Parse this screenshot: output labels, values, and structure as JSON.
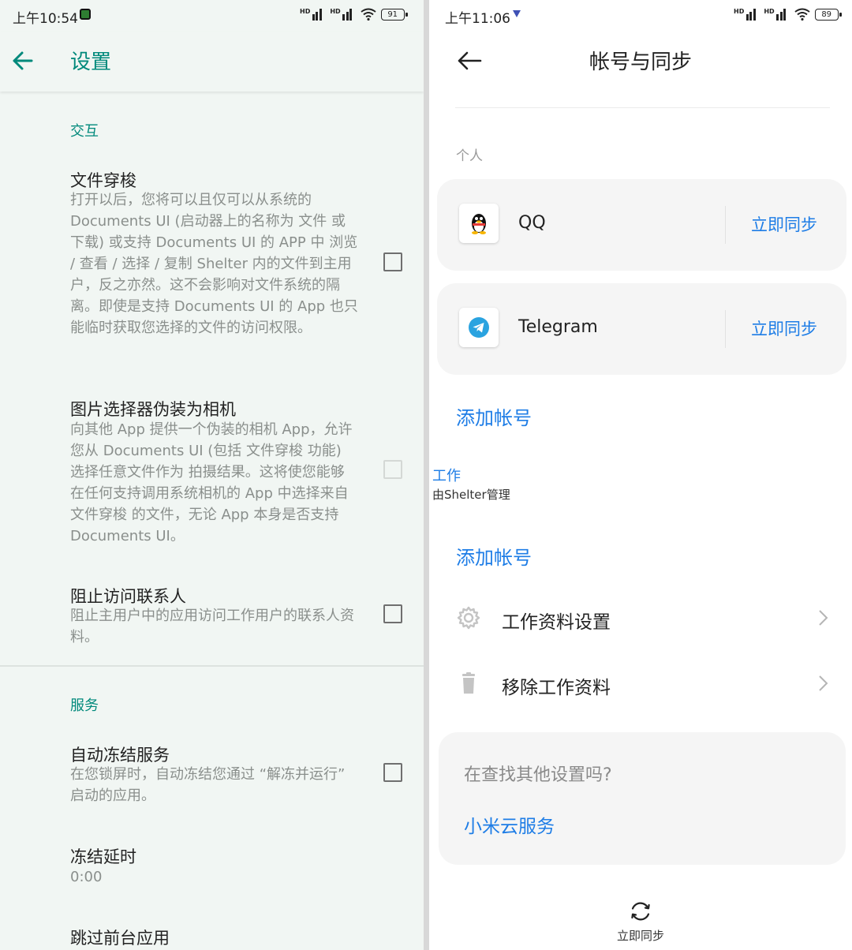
{
  "left": {
    "status_time": "上午10:54",
    "battery": "91",
    "title": "设置",
    "sections": [
      {
        "header": "交互",
        "items": [
          {
            "title": "文件穿梭",
            "summary": "打开以后，您将可以且仅可以从系统的 Documents UI (启动器上的名称为 文件 或 下载) 或支持 Documents UI 的 APP 中 浏览 / 查看 / 选择 / 复制 Shelter 内的文件到主用户，反之亦然。这不会影响对文件系统的隔离。即使是支持 Documents UI 的 App 也只能临时获取您选择的文件的访问权限。",
            "checked": false,
            "enabled": true
          },
          {
            "title": "图片选择器伪装为相机",
            "summary": "向其他 App 提供一个伪装的相机 App，允许您从 Documents UI (包括 文件穿梭 功能) 选择任意文件作为 拍摄结果。这将使您能够在任何支持调用系统相机的 App 中选择来自 文件穿梭 的文件，无论 App 本身是否支持 Documents UI。",
            "checked": false,
            "enabled": false
          },
          {
            "title": "阻止访问联系人",
            "summary": "阻止主用户中的应用访问工作用户的联系人资料。",
            "checked": false,
            "enabled": true
          }
        ]
      },
      {
        "header": "服务",
        "items": [
          {
            "title": "自动冻结服务",
            "summary": "在您锁屏时，自动冻结您通过 “解冻并运行” 启动的应用。",
            "checked": false,
            "enabled": true
          },
          {
            "title": "冻结延时",
            "summary": "0:00"
          },
          {
            "title": "跳过前台应用"
          }
        ]
      }
    ]
  },
  "right": {
    "status_time": "上午11:06",
    "battery": "89",
    "title": "帐号与同步",
    "personal_label": "个人",
    "accounts": [
      {
        "name": "QQ",
        "icon": "qq-penguin-icon",
        "sync_label": "立即同步"
      },
      {
        "name": "Telegram",
        "icon": "telegram-icon",
        "sync_label": "立即同步"
      }
    ],
    "add_account_label": "添加帐号",
    "work_label": "工作",
    "work_subtitle": "由Shelter管理",
    "work_add_account_label": "添加帐号",
    "rows": [
      {
        "title": "工作资料设置",
        "icon": "gear-icon"
      },
      {
        "title": "移除工作资料",
        "icon": "trash-icon"
      }
    ],
    "help_question": "在查找其他设置吗?",
    "help_link": "小米云服务",
    "bottom_sync_label": "立即同步"
  },
  "colors": {
    "left_accent": "#00897b",
    "right_accent": "#1e7de6",
    "left_background": "#f1f6f3"
  }
}
